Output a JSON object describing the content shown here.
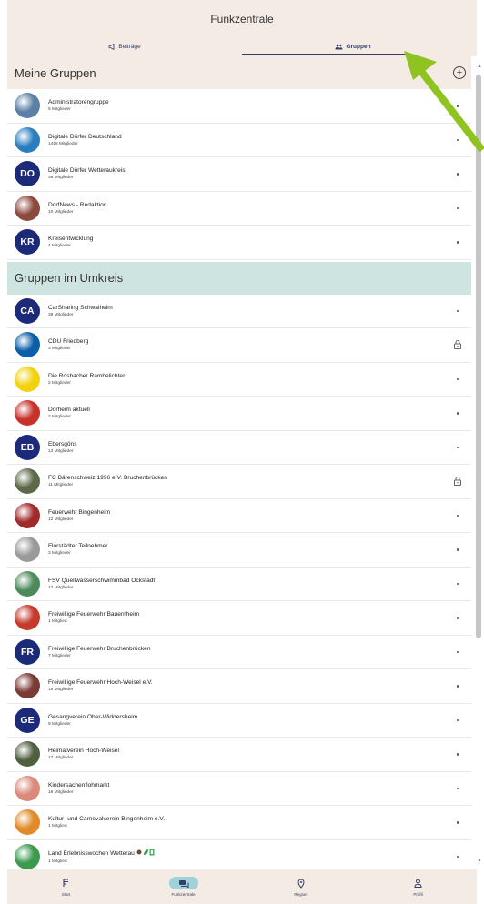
{
  "header": {
    "title": "Funkzentrale",
    "tabs": [
      {
        "label": "Beiträge",
        "icon": "megaphone-icon"
      },
      {
        "label": "Gruppen",
        "icon": "group-icon",
        "active": true
      }
    ]
  },
  "sections": {
    "meine": {
      "title": "Meine Gruppen",
      "add_icon": "plus-circle-icon",
      "groups": [
        {
          "name": "Administratorengruppe",
          "members": "5 Mitglieder",
          "avatar": "image",
          "color": "#5b7fa6"
        },
        {
          "name": "Digitale Dörfer Deutschland",
          "members": "1498 Mitglieder",
          "avatar": "image",
          "color": "#2a7dbf"
        },
        {
          "name": "Digitale Dörfer Wetteraukreis",
          "members": "38 Mitglieder",
          "avatar": "DO"
        },
        {
          "name": "DorfNews - Redaktion",
          "members": "10 Mitglieder",
          "avatar": "image",
          "color": "#8b4a3c"
        },
        {
          "name": "Kreisentwicklung",
          "members": "4 Mitglieder",
          "avatar": "KR"
        }
      ]
    },
    "umkreis": {
      "title": "Gruppen im Umkreis",
      "groups": [
        {
          "name": "CarSharing Schwalheim",
          "members": "39 Mitglieder",
          "avatar": "CA"
        },
        {
          "name": "CDU Friedberg",
          "members": "3 Mitglieder",
          "avatar": "image",
          "color": "#0b5ea8",
          "locked": true
        },
        {
          "name": "Die Rosbacher Rambelichter",
          "members": "2 Mitglieder",
          "avatar": "image",
          "color": "#f2d20e"
        },
        {
          "name": "Dorheim aktuell",
          "members": "2 Mitglieder",
          "avatar": "image",
          "color": "#c8302b"
        },
        {
          "name": "Ebersgöns",
          "members": "13 Mitglieder",
          "avatar": "EB"
        },
        {
          "name": "FC Bärenschweiz 1996 e.V. Bruchenbrücken",
          "members": "11 Mitglieder",
          "avatar": "image",
          "color": "#5c6a4a",
          "locked": true
        },
        {
          "name": "Feuerwehr Bingenheim",
          "members": "12 Mitglieder",
          "avatar": "image",
          "color": "#a02b2b"
        },
        {
          "name": "Florstädter Teilnehmer",
          "members": "3 Mitglieder",
          "avatar": "image",
          "color": "#9a9a9a"
        },
        {
          "name": "FSV Quellwasserschwimmbad Ockstadt",
          "members": "12 Mitglieder",
          "avatar": "image",
          "color": "#4d8a5b"
        },
        {
          "name": "Freiwillige Feuerwehr Bauernheim",
          "members": "1 Mitglied",
          "avatar": "image",
          "color": "#c53a2c"
        },
        {
          "name": "Freiwillige Feuerwehr Bruchenbrücken",
          "members": "7 Mitglieder",
          "avatar": "FR"
        },
        {
          "name": "Freiwillige Feuerwehr Hoch-Weisel e.V.",
          "members": "15 Mitglieder",
          "avatar": "image",
          "color": "#7a3b34"
        },
        {
          "name": "Gesangverein Ober-Widdersheim",
          "members": "9 Mitglieder",
          "avatar": "GE"
        },
        {
          "name": "Heimatverein Hoch-Weisel",
          "members": "17 Mitglieder",
          "avatar": "image",
          "color": "#4f5f3f"
        },
        {
          "name": "Kindersachenflohmarkt",
          "members": "18 Mitglieder",
          "avatar": "image",
          "color": "#d98a7a"
        },
        {
          "name": "Kultur- und Carnevalverein Bingenheim e.V.",
          "members": "1 Mitglied",
          "avatar": "image",
          "color": "#e08a2a"
        },
        {
          "name": "Land Erlebnisswochen Wetterau",
          "members": "1 Mitglied",
          "avatar": "image",
          "color": "#3c9a4e"
        }
      ]
    }
  },
  "bottom_nav": [
    {
      "label": "Start",
      "icon": "home-list-icon"
    },
    {
      "label": "Funkzentrale",
      "icon": "chat-icon",
      "active": true
    },
    {
      "label": "Region",
      "icon": "location-pin-icon"
    },
    {
      "label": "Profil",
      "icon": "person-icon"
    }
  ],
  "colors": {
    "header_bg": "#f4ece4",
    "umkreis_bg": "#cde4e0",
    "accent_navy": "#34406a",
    "initials_bg": "#1c2a7a",
    "annotation_arrow": "#8fc31f"
  }
}
